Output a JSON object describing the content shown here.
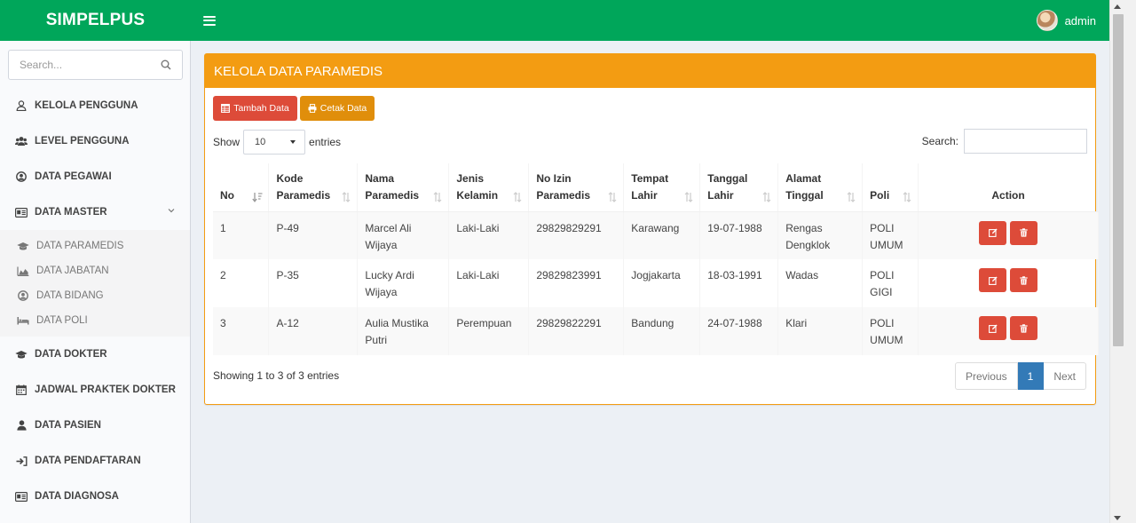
{
  "app": {
    "title": "SIMPELPUS",
    "user": "admin"
  },
  "sidebar": {
    "search_placeholder": "Search...",
    "items": [
      {
        "label": "KELOLA PENGGUNA",
        "icon": "user-icon"
      },
      {
        "label": "LEVEL PENGGUNA",
        "icon": "users-icon"
      },
      {
        "label": "DATA PEGAWAI",
        "icon": "user-circle-icon"
      },
      {
        "label": "DATA MASTER",
        "icon": "id-card-icon",
        "expanded": true
      }
    ],
    "sub_items": [
      {
        "label": "DATA PARAMEDIS",
        "icon": "graduation-cap-icon"
      },
      {
        "label": "DATA JABATAN",
        "icon": "area-chart-icon"
      },
      {
        "label": "DATA BIDANG",
        "icon": "user-circle-icon"
      },
      {
        "label": "DATA POLI",
        "icon": "bed-icon"
      }
    ],
    "items_after": [
      {
        "label": "DATA DOKTER",
        "icon": "graduation-cap-icon"
      },
      {
        "label": "JADWAL PRAKTEK DOKTER",
        "icon": "calendar-icon"
      },
      {
        "label": "DATA PASIEN",
        "icon": "user-icon"
      },
      {
        "label": "DATA PENDAFTARAN",
        "icon": "sign-in-icon"
      },
      {
        "label": "DATA DIAGNOSA",
        "icon": "id-card-icon"
      }
    ]
  },
  "box": {
    "title": "KELOLA DATA PARAMEDIS",
    "add_label": "Tambah Data",
    "print_label": "Cetak Data",
    "show_label": "Show",
    "entries_label": "entries",
    "page_length": "10",
    "search_label": "Search:",
    "search_value": "",
    "columns": [
      {
        "label": "No"
      },
      {
        "label": "Kode Paramedis"
      },
      {
        "label": "Nama Paramedis"
      },
      {
        "label": "Jenis Kelamin"
      },
      {
        "label": "No Izin Paramedis"
      },
      {
        "label": "Tempat Lahir"
      },
      {
        "label": "Tanggal Lahir"
      },
      {
        "label": "Alamat Tinggal"
      },
      {
        "label": "Poli"
      },
      {
        "label": "Action"
      }
    ],
    "rows": [
      {
        "no": "1",
        "kode": "P-49",
        "nama": "Marcel Ali Wijaya",
        "jk": "Laki-Laki",
        "izin": "29829829291",
        "tempat": "Karawang",
        "tanggal": "19-07-1988",
        "alamat": "Rengas Dengklok",
        "poli": "POLI UMUM"
      },
      {
        "no": "2",
        "kode": "P-35",
        "nama": "Lucky Ardi Wijaya",
        "jk": "Laki-Laki",
        "izin": "29829823991",
        "tempat": "Jogjakarta",
        "tanggal": "18-03-1991",
        "alamat": "Wadas",
        "poli": "POLI GIGI"
      },
      {
        "no": "3",
        "kode": "A-12",
        "nama": "Aulia Mustika Putri",
        "jk": "Perempuan",
        "izin": "29829822291",
        "tempat": "Bandung",
        "tanggal": "24-07-1988",
        "alamat": "Klari",
        "poli": "POLI UMUM"
      }
    ],
    "info": "Showing 1 to 3 of 3 entries",
    "pagination": {
      "previous": "Previous",
      "current": "1",
      "next": "Next"
    }
  }
}
